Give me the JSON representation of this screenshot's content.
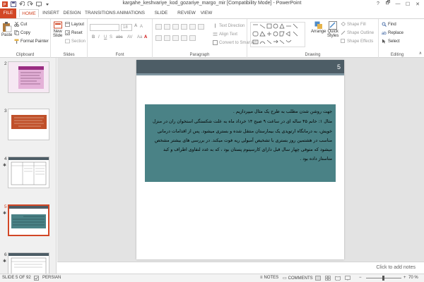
{
  "window": {
    "title": "kargahe_keshvariye_kod_gozariye_margo_mir [Compatibility Mode] - PowerPoint",
    "controls": [
      "?",
      "🗗",
      "—",
      "☐",
      "✕"
    ]
  },
  "tabs": [
    "FILE",
    "HOME",
    "INSERT",
    "DESIGN",
    "TRANSITIONS",
    "ANIMATIONS",
    "SLIDE SHOW",
    "REVIEW",
    "VIEW"
  ],
  "active_tab": "HOME",
  "ribbon": {
    "clipboard": {
      "paste": "Paste",
      "cut": "Cut",
      "copy": "Copy",
      "format_painter": "Format Painter",
      "label": "Clipboard"
    },
    "slides": {
      "new_slide_1": "New",
      "new_slide_2": "Slide",
      "layout": "Layout",
      "reset": "Reset",
      "section": "Section",
      "label": "Slides"
    },
    "font": {
      "size_value": "18",
      "label": "Font"
    },
    "paragraph": {
      "text_direction": "Text Direction",
      "align_text": "Align Text",
      "smartart": "Convert to SmartArt",
      "label": "Paragraph"
    },
    "drawing": {
      "arrange": "Arrange",
      "quick_styles_1": "Quick",
      "quick_styles_2": "Styles",
      "shape_fill": "Shape Fill",
      "shape_outline": "Shape Outline",
      "shape_effects": "Shape Effects",
      "label": "Drawing"
    },
    "editing": {
      "find": "Find",
      "replace": "Replace",
      "select": "Select",
      "label": "Editing"
    }
  },
  "thumbnails": [
    {
      "number": "2"
    },
    {
      "number": "3"
    },
    {
      "number": "4"
    },
    {
      "number": "5"
    },
    {
      "number": "6"
    }
  ],
  "slide": {
    "number": "5",
    "line1": "جهت روشن شدن مطلب به طرح یک مثال میپردازیم .",
    "line2": "مثال ۱: خانم ۴۵ ساله ای در ساعت ۹ صبح ۱۴ خرداد ماه به علت شکستگی استخوان ران در منزل خویش، به درمانگاه ارتوپدی یک بیمارستان منتقل شده و بستری میشود. پس از اقدامات درمانی مناسب در هشتمین روز بستری با تشخیص آمبولی ریه فوت میکند. در بررسی های بیشتر مشخص میشود که متوفی چهار سال قبل دارای کارسینوم پستان بود ، که به غدد لنفاوی اطراف و کبد متاستاز داده بود ."
  },
  "notes_hint": "Click to add notes",
  "status": {
    "slide_of": "SLIDE 5 OF 92",
    "language": "PERSIAN",
    "notes": "NOTES",
    "comments": "COMMENTS",
    "zoom": "70 %"
  },
  "colors": {
    "accent": "#d24726",
    "slide_bar": "#4d5d66",
    "text_box": "#4a8286"
  }
}
